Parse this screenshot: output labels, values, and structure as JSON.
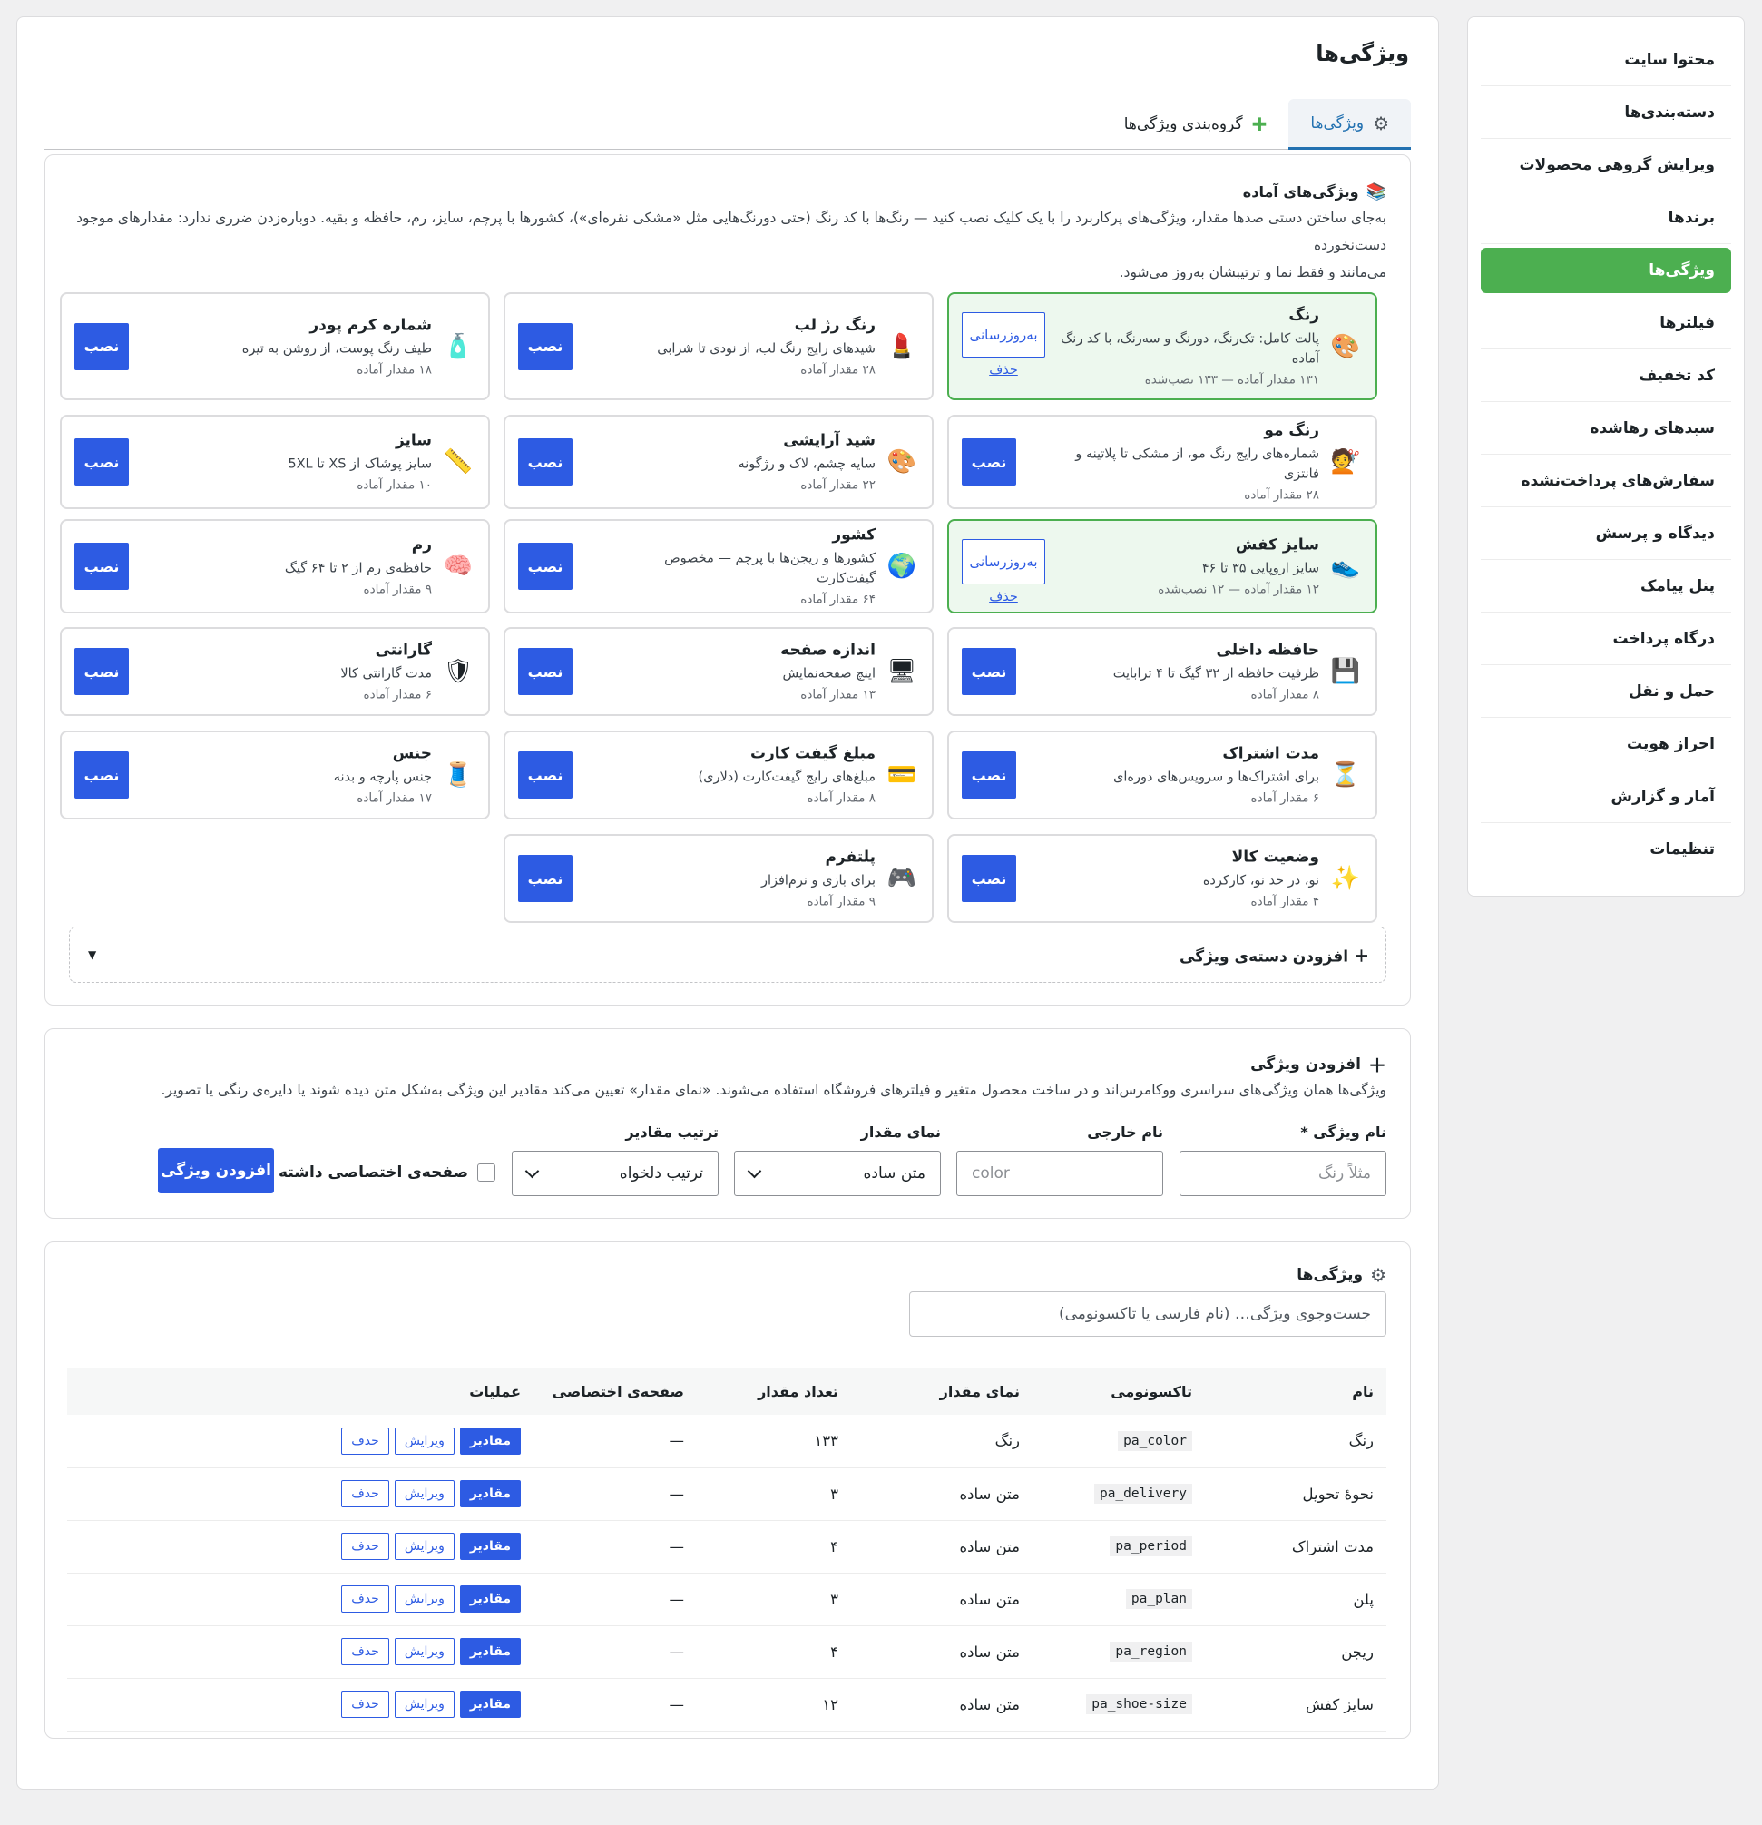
{
  "sidebar": {
    "items": [
      {
        "label": "محتوا سایت",
        "active": false
      },
      {
        "label": "دسته‌بندی‌ها",
        "active": false
      },
      {
        "label": "ویرایش گروهی محصولات",
        "active": false
      },
      {
        "label": "برندها",
        "active": false
      },
      {
        "label": "ویژگی‌ها",
        "active": true
      },
      {
        "label": "فیلترها",
        "active": false
      },
      {
        "label": "کد تخفیف",
        "active": false
      },
      {
        "label": "سبدهای رهاشده",
        "active": false
      },
      {
        "label": "سفارش‌های پرداخت‌نشده",
        "active": false
      },
      {
        "label": "دیدگاه و پرسش",
        "active": false
      },
      {
        "label": "پنل پیامک",
        "active": false
      },
      {
        "label": "درگاه پرداخت",
        "active": false
      },
      {
        "label": "حمل و نقل",
        "active": false
      },
      {
        "label": "احراز هویت",
        "active": false
      },
      {
        "label": "آمار و گزارش",
        "active": false
      },
      {
        "label": "تنظیمات",
        "active": false
      }
    ]
  },
  "page": {
    "title": "ویژگی‌ها"
  },
  "tabs": [
    {
      "label": "ویژگی‌ها",
      "icon": "gear-icon",
      "active": true
    },
    {
      "label": "گروه‌بندی ویژگی‌ها",
      "icon": "puzzle-icon",
      "active": false
    }
  ],
  "presets": {
    "title": "ویژگی‌های آماده",
    "icon": "books-icon",
    "desc_line1": "به‌جای ساختن دستی صدها مقدار، ویژگی‌های پرکاربرد را با یک کلیک نصب کنید — رنگ‌ها با کد رنگ (حتی دورنگ‌هایی مثل «مشکی نقره‌ای»)، کشورها با پرچم، سایز، رم، حافظه و بقیه. دوباره‌زدن ضرری ندارد: مقدارهای موجود دست‌نخورده",
    "desc_line2": "می‌مانند و فقط نما و ترتیبشان به‌روز می‌شود.",
    "install_label": "نصب",
    "update_label": "به‌روزرسانی",
    "delete_label": "حذف",
    "items": [
      {
        "title": "رنگ",
        "desc": "پالت کامل: تک‌رنگ، دورنگ و سه‌رنگ، با کد رنگ آماده",
        "meta": "۱۳۱ مقدار آماده — ۱۳۳ نصب‌شده",
        "icon": "palette-icon",
        "glyph": "🎨",
        "installed": true
      },
      {
        "title": "رنگ رژ لب",
        "desc": "شیدهای رایج رنگ لب، از نودی تا شرابی",
        "meta": "۲۸ مقدار آماده",
        "icon": "lipstick-icon",
        "glyph": "💄",
        "installed": false
      },
      {
        "title": "شماره کرم پودر",
        "desc": "طیف رنگ پوست، از روشن به تیره",
        "meta": "۱۸ مقدار آماده",
        "icon": "lotion-bottle-icon",
        "glyph": "🧴",
        "installed": false
      },
      {
        "title": "رنگ مو",
        "desc": "شماره‌های رایج رنگ مو، از مشکی تا پلاتینه و فانتزی",
        "meta": "۲۸ مقدار آماده",
        "icon": "hairdresser-icon",
        "glyph": "💇",
        "installed": false
      },
      {
        "title": "شید آرایشی",
        "desc": "سایه چشم، لاک و رژگونه",
        "meta": "۲۲ مقدار آماده",
        "icon": "palette-icon",
        "glyph": "🎨",
        "installed": false
      },
      {
        "title": "سایز",
        "desc": "سایز پوشاک از XS تا 5XL",
        "meta": "۱۰ مقدار آماده",
        "icon": "ruler-icon",
        "glyph": "📏",
        "installed": false
      },
      {
        "title": "سایز کفش",
        "desc": "سایز اروپایی ۳۵ تا ۴۶",
        "meta": "۱۲ مقدار آماده — ۱۲ نصب‌شده",
        "icon": "shoe-icon",
        "glyph": "👟",
        "installed": true
      },
      {
        "title": "کشور",
        "desc": "کشورها و ریجن‌ها با پرچم — مخصوص گیفت‌کارت",
        "meta": "۶۴ مقدار آماده",
        "icon": "globe-icon",
        "glyph": "🌍",
        "installed": false
      },
      {
        "title": "رم",
        "desc": "حافظه‌ی رم از ۲ تا ۶۴ گیگ",
        "meta": "۹ مقدار آماده",
        "icon": "brain-icon",
        "glyph": "🧠",
        "installed": false
      },
      {
        "title": "حافظه داخلی",
        "desc": "ظرفیت حافظه از ۳۲ گیگ تا ۴ ترابایت",
        "meta": "۸ مقدار آماده",
        "icon": "floppy-disk-icon",
        "glyph": "💾",
        "installed": false
      },
      {
        "title": "اندازه صفحه",
        "desc": "اینچ صفحه‌نمایش",
        "meta": "۱۳ مقدار آماده",
        "icon": "monitor-icon",
        "glyph": "🖥",
        "installed": false
      },
      {
        "title": "گارانتی",
        "desc": "مدت گارانتی کالا",
        "meta": "۶ مقدار آماده",
        "icon": "shield-icon",
        "glyph": "🛡",
        "installed": false
      },
      {
        "title": "مدت اشتراک",
        "desc": "برای اشتراک‌ها و سرویس‌های دوره‌ای",
        "meta": "۶ مقدار آماده",
        "icon": "hourglass-icon",
        "glyph": "⏳",
        "installed": false
      },
      {
        "title": "مبلغ گیفت کارت",
        "desc": "مبلغ‌های رایج گیفت‌کارت (دلاری)",
        "meta": "۸ مقدار آماده",
        "icon": "credit-card-icon",
        "glyph": "💳",
        "installed": false
      },
      {
        "title": "جنس",
        "desc": "جنس پارچه و بدنه",
        "meta": "۱۷ مقدار آماده",
        "icon": "thread-spool-icon",
        "glyph": "🧵",
        "installed": false
      },
      {
        "title": "وضعیت کالا",
        "desc": "نو، در حد نو، کارکرده",
        "meta": "۴ مقدار آماده",
        "icon": "sparkles-icon",
        "glyph": "✨",
        "installed": false
      },
      {
        "title": "پلتفرم",
        "desc": "برای بازی و نرم‌افزار",
        "meta": "۹ مقدار آماده",
        "icon": "gamepad-icon",
        "glyph": "🎮",
        "installed": false
      }
    ],
    "add_group_label": "افزودن دسته‌ی ویژگی"
  },
  "add_form": {
    "title": "افزودن ویژگی",
    "desc": "ویژگی‌ها همان ویژگی‌های سراسری ووکامرس‌اند و در ساخت محصول متغیر و فیلترهای فروشگاه استفاده می‌شوند. «نمای مقدار» تعیین می‌کند مقادیر این ویژگی به‌شکل متن دیده شوند یا دایره‌ی رنگی یا تصویر.",
    "name_label": "نام ویژگی *",
    "name_placeholder": "مثلاً رنگ",
    "slug_label": "نام خارجی",
    "slug_placeholder": "color",
    "view_label": "نمای مقدار",
    "view_value": "متن ساده",
    "order_label": "ترتیب مقادیر",
    "order_value": "ترتیب دلخواه",
    "archive_label": "صفحه‌ی اختصاصی داشته باشد",
    "submit_label": "افزودن ویژگی"
  },
  "list": {
    "title": "ویژگی‌ها",
    "search_placeholder": "جست‌وجوی ویژگی… (نام فارسی یا تاکسونومی)",
    "columns": [
      "نام",
      "تاکسونومی",
      "نمای مقدار",
      "تعداد مقدار",
      "صفحه‌ی اختصاصی",
      "عملیات"
    ],
    "op_values": "مقادیر",
    "op_edit": "ویرایش",
    "op_delete": "حذف",
    "rows": [
      {
        "name": "رنگ",
        "taxonomy": "pa_color",
        "view": "رنگ",
        "count": "۱۳۳",
        "archive": "—"
      },
      {
        "name": "نحوهٔ تحویل",
        "taxonomy": "pa_delivery",
        "view": "متن ساده",
        "count": "۳",
        "archive": "—"
      },
      {
        "name": "مدت اشتراک",
        "taxonomy": "pa_period",
        "view": "متن ساده",
        "count": "۴",
        "archive": "—"
      },
      {
        "name": "پلن",
        "taxonomy": "pa_plan",
        "view": "متن ساده",
        "count": "۳",
        "archive": "—"
      },
      {
        "name": "ریجن",
        "taxonomy": "pa_region",
        "view": "متن ساده",
        "count": "۴",
        "archive": "—"
      },
      {
        "name": "سایز کفش",
        "taxonomy": "pa_shoe-size",
        "view": "متن ساده",
        "count": "۱۲",
        "archive": "—"
      }
    ]
  },
  "colors": {
    "accent": "#2d5be3",
    "active_green": "#4caf50",
    "tab_blue": "#2271b1"
  }
}
